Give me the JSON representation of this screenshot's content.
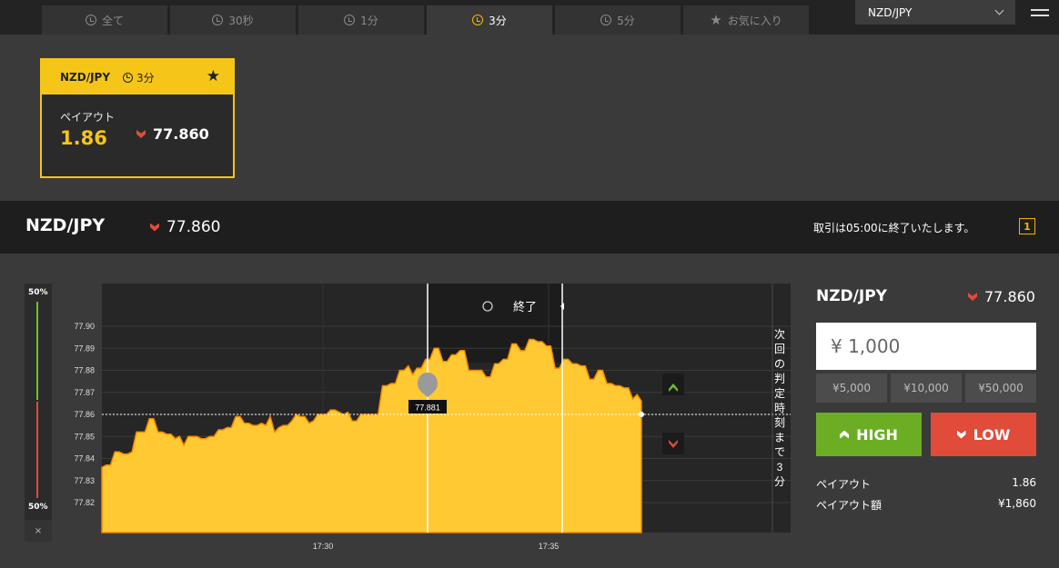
{
  "tabs": [
    {
      "label": "全て",
      "icon": "clock-icon"
    },
    {
      "label": "30秒",
      "icon": "clock-icon"
    },
    {
      "label": "1分",
      "icon": "clock-icon"
    },
    {
      "label": "3分",
      "icon": "clock-icon",
      "active": true
    },
    {
      "label": "5分",
      "icon": "clock-icon"
    },
    {
      "label": "お気に入り",
      "icon": "star-icon"
    }
  ],
  "pair_select": "NZD/JPY",
  "card": {
    "pair": "NZD/JPY",
    "time": "3分",
    "payout_label": "ペイアウト",
    "payout": "1.86",
    "rate": "77.860"
  },
  "strip": {
    "pair": "NZD/JPY",
    "rate": "77.860",
    "notice": "取引は05:00に終了いたします。",
    "icon_text": "1"
  },
  "sentiment": {
    "top": "50%",
    "bottom": "50%",
    "close": "×"
  },
  "chart_data": {
    "type": "area",
    "ylim": [
      77.81,
      77.91
    ],
    "y_ticks": [
      "77.90",
      "77.89",
      "77.88",
      "77.87",
      "77.86",
      "77.85",
      "77.84",
      "77.83",
      "77.82"
    ],
    "x_ticks": [
      "17:30",
      "17:35"
    ],
    "entry_rate_label": "77.881",
    "end_label": "終了",
    "side_text": "次回の判定時刻まで3分",
    "x": [
      0,
      2,
      4,
      6,
      8,
      10,
      12,
      14,
      16,
      18,
      20,
      22,
      24,
      26,
      28,
      30,
      32,
      34,
      36,
      38,
      40,
      42,
      44,
      46,
      48,
      50,
      52,
      54,
      56,
      58,
      60,
      62,
      64,
      66,
      68,
      70,
      72,
      74,
      76,
      78,
      80,
      82,
      84,
      86,
      88,
      90,
      92,
      94,
      96,
      98,
      100,
      102,
      104,
      106,
      108,
      110,
      112,
      114,
      116,
      118,
      120,
      122,
      124,
      126,
      128,
      130,
      132,
      134,
      136,
      138,
      140,
      142,
      144,
      146,
      148,
      150,
      152,
      154,
      156,
      158,
      160,
      162,
      164,
      166,
      168,
      170,
      172,
      174,
      176,
      178,
      180,
      182,
      184,
      186,
      188,
      190,
      192,
      194,
      196,
      198,
      200,
      202,
      204,
      206,
      208,
      210,
      212,
      214,
      216,
      218,
      220,
      222,
      224,
      226,
      228,
      230,
      232,
      234,
      236,
      238,
      240,
      242,
      244,
      246,
      248,
      250
    ],
    "values": [
      77.836,
      77.837,
      77.837,
      77.843,
      77.843,
      77.842,
      77.842,
      77.843,
      77.852,
      77.852,
      77.852,
      77.858,
      77.858,
      77.852,
      77.852,
      77.851,
      77.851,
      77.849,
      77.85,
      77.846,
      77.85,
      77.85,
      77.85,
      77.849,
      77.849,
      77.85,
      77.85,
      77.853,
      77.853,
      77.854,
      77.854,
      77.859,
      77.859,
      77.856,
      77.856,
      77.855,
      77.855,
      77.856,
      77.855,
      77.859,
      77.852,
      77.854,
      77.855,
      77.855,
      77.857,
      77.86,
      77.859,
      77.859,
      77.856,
      77.857,
      77.86,
      77.86,
      77.86,
      77.862,
      77.862,
      77.861,
      77.86,
      77.861,
      77.857,
      77.857,
      77.86,
      77.86,
      77.86,
      77.86,
      77.86,
      77.873,
      77.873,
      77.874,
      77.874,
      77.88,
      77.88,
      77.882,
      77.878,
      77.881,
      77.881,
      77.885,
      77.885,
      77.89,
      77.89,
      77.884,
      77.884,
      77.887,
      77.887,
      77.889,
      77.889,
      77.88,
      77.88,
      77.88,
      77.88,
      77.877,
      77.877,
      77.883,
      77.883,
      77.885,
      77.885,
      77.892,
      77.892,
      77.889,
      77.889,
      77.894,
      77.894,
      77.893,
      77.893,
      77.891,
      77.891,
      77.881,
      77.881,
      77.885,
      77.885,
      77.883,
      77.883,
      77.882,
      77.882,
      77.876,
      77.876,
      77.88,
      77.88,
      77.874,
      77.874,
      77.873,
      77.873,
      77.872,
      77.872,
      77.867,
      77.869,
      77.866
    ]
  },
  "panel": {
    "pair": "NZD/JPY",
    "rate": "77.860",
    "amount": "¥ 1,000",
    "quick": [
      "¥5,000",
      "¥10,000",
      "¥50,000"
    ],
    "high": "HIGH",
    "low": "LOW",
    "payout_label": "ペイアウト",
    "payout": "1.86",
    "payout_amount_label": "ペイアウト額",
    "payout_amount": "¥1,860"
  },
  "colors": {
    "accent": "#f5c518",
    "high": "#6cae23",
    "low": "#e04b3a"
  }
}
